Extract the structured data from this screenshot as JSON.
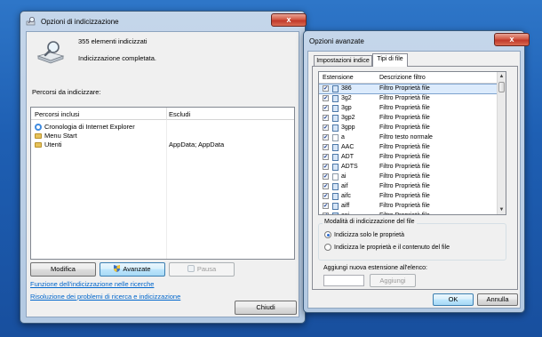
{
  "window_left": {
    "title": "Opzioni di indicizzazione",
    "close_label": "x",
    "items_indexed": "355 elementi indicizzati",
    "status": "Indicizzazione completata.",
    "paths_label": "Percorsi da indicizzare:",
    "columns": [
      "Percorsi inclusi",
      "Escludi"
    ],
    "rows": [
      {
        "name": "Cronologia di Internet Explorer",
        "exclude": "",
        "icon": "ie-icon"
      },
      {
        "name": "Menu Start",
        "exclude": "",
        "icon": "folder-icon"
      },
      {
        "name": "Utenti",
        "exclude": "AppData; AppData",
        "icon": "folder-icon"
      }
    ],
    "buttons": {
      "modify": "Modifica",
      "advanced": "Avanzate",
      "pause": "Pausa",
      "close": "Chiudi"
    },
    "links": [
      "Funzione dell'indicizzazione nelle ricerche",
      "Risoluzione dei problemi di ricerca e indicizzazione"
    ]
  },
  "window_right": {
    "title": "Opzioni avanzate",
    "close_label": "x",
    "tabs": [
      "Impostazioni indice",
      "Tipi di file"
    ],
    "active_tab": "Tipi di file",
    "columns": [
      "Estensione",
      "Descrizione filtro"
    ],
    "rows": [
      {
        "ext": "386",
        "desc": "Filtro Proprietà file",
        "selected": true
      },
      {
        "ext": "3g2",
        "desc": "Filtro Proprietà file"
      },
      {
        "ext": "3gp",
        "desc": "Filtro Proprietà file"
      },
      {
        "ext": "3gp2",
        "desc": "Filtro Proprietà file"
      },
      {
        "ext": "3gpp",
        "desc": "Filtro Proprietà file"
      },
      {
        "ext": "a",
        "desc": "Filtro testo normale"
      },
      {
        "ext": "AAC",
        "desc": "Filtro Proprietà file"
      },
      {
        "ext": "ADT",
        "desc": "Filtro Proprietà file"
      },
      {
        "ext": "ADTS",
        "desc": "Filtro Proprietà file"
      },
      {
        "ext": "ai",
        "desc": "Filtro Proprietà file"
      },
      {
        "ext": "aif",
        "desc": "Filtro Proprietà file"
      },
      {
        "ext": "aifc",
        "desc": "Filtro Proprietà file"
      },
      {
        "ext": "aiff",
        "desc": "Filtro Proprietà file"
      },
      {
        "ext": "ani",
        "desc": "Filtro Proprietà file"
      }
    ],
    "group_title": "Modalità di indicizzazione del file",
    "radio_options": [
      "Indicizza solo le proprietà",
      "Indicizza le proprietà e il contenuto del file"
    ],
    "selected_option": 0,
    "new_ext_label": "Aggiungi nuova estensione all'elenco:",
    "new_ext_value": "",
    "buttons": {
      "add": "Aggiungi",
      "ok": "OK",
      "cancel": "Annulla"
    }
  },
  "colors": {
    "desktop": "#1e5fb3",
    "close": "#c0392b",
    "link": "#0066cc",
    "selection": "#dcebfc"
  }
}
